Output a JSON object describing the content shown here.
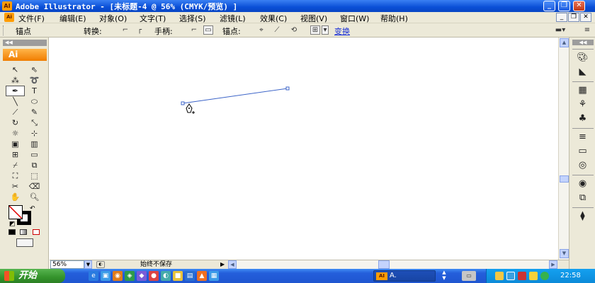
{
  "window": {
    "app_icon": "AI",
    "title": "Adobe Illustrator - [未标题-4 @ 56% (CMYK/预览) ]",
    "buttons": [
      "minimize-icon",
      "restore-icon",
      "close-icon"
    ]
  },
  "menu": {
    "items": [
      "文件(F)",
      "编辑(E)",
      "对象(O)",
      "文字(T)",
      "选择(S)",
      "滤镜(L)",
      "效果(C)",
      "视图(V)",
      "窗口(W)",
      "帮助(H)"
    ]
  },
  "controlbar": {
    "anchor_label": "锚点",
    "convert_label": "转换:",
    "handles_label": "手柄:",
    "anchors_label": "锚点:",
    "transform_link": "变换"
  },
  "toolbox": {
    "header": "◀◀",
    "badge": "Ai",
    "tools": [
      "selection-tool",
      "direct-selection-tool",
      "magic-wand-tool",
      "lasso-tool",
      "pen-tool",
      "type-tool",
      "line-segment-tool",
      "ellipse-tool",
      "paintbrush-tool",
      "pencil-tool",
      "rotate-tool",
      "scale-tool",
      "warp-tool",
      "free-transform-tool",
      "symbol-sprayer-tool",
      "column-graph-tool",
      "mesh-tool",
      "gradient-tool",
      "eyedropper-tool",
      "blend-tool",
      "live-paint-bucket-tool",
      "live-paint-selection-tool",
      "slice-tool",
      "eraser-tool",
      "hand-tool",
      "zoom-tool"
    ],
    "active_tool": "pen-tool"
  },
  "dock": {
    "header": "◀◀"
  },
  "statusbar": {
    "zoom": "56%",
    "status_text": "始终不保存"
  },
  "canvas": {
    "stroke_color": "#3c64c8"
  },
  "taskbar": {
    "start_label": "开始",
    "task_label": "A.",
    "task_icon": "AI",
    "clock": "22:58"
  }
}
